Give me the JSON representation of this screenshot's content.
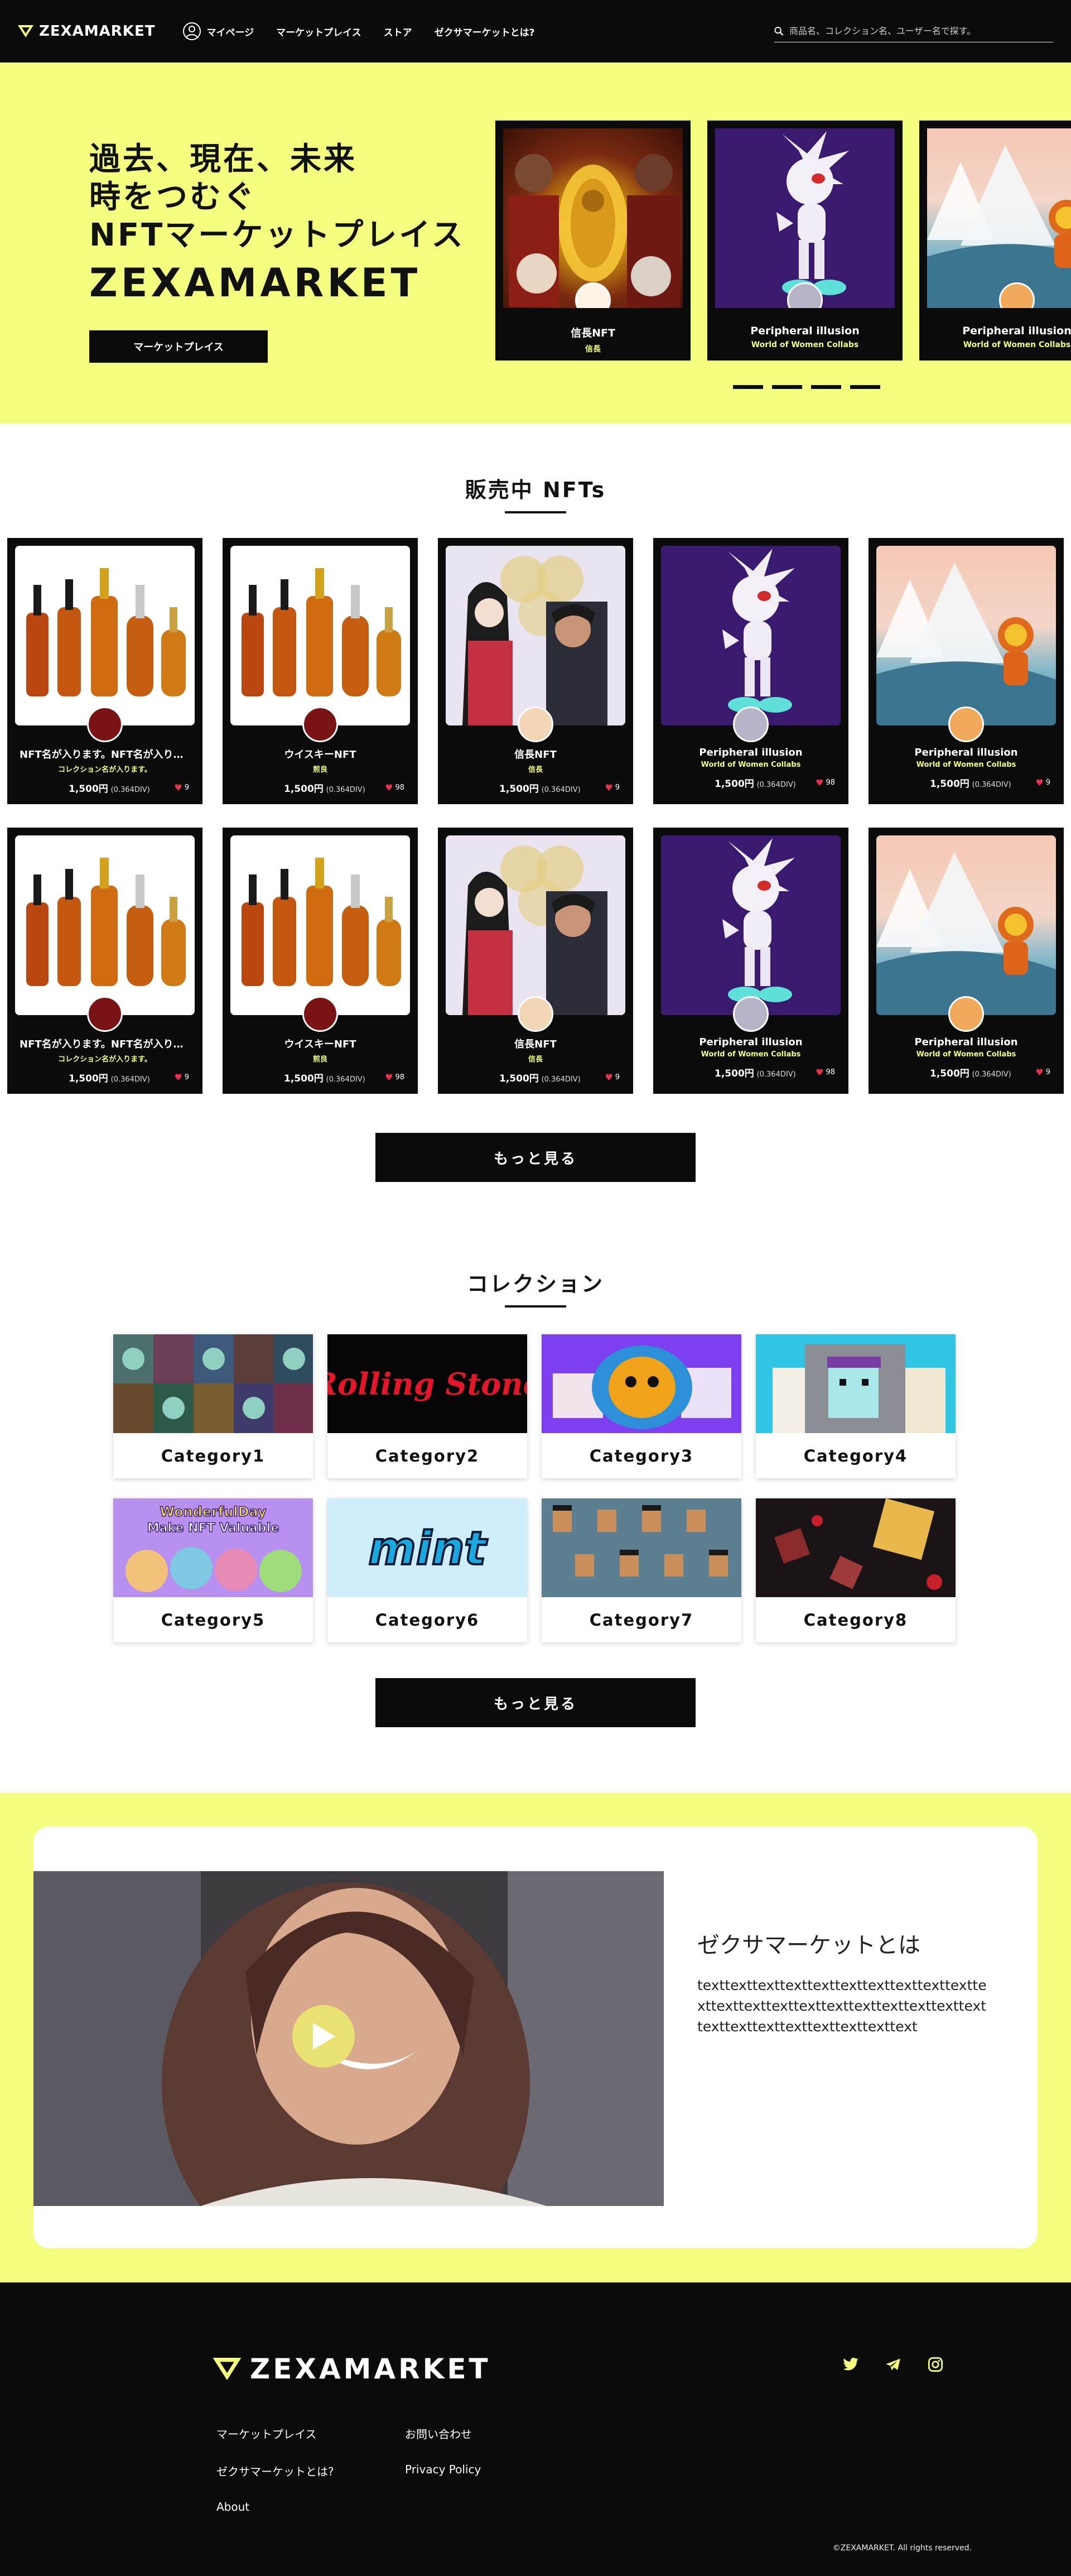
{
  "header": {
    "logo": "ZEXAMARKET",
    "nav": [
      {
        "label": "マイページ"
      },
      {
        "label": "マーケットプレイス"
      },
      {
        "label": "ストア"
      },
      {
        "label": "ゼクサマーケットとは?"
      }
    ],
    "search_placeholder": "商品名、コレクション名、ユーザー名で探す。"
  },
  "hero": {
    "lines": [
      "過去、現在、未来",
      "時をつむぐ",
      "NFTマーケットプレイス"
    ],
    "brand": "ZEXAMARKET",
    "button": "マーケットプレイス",
    "cards": [
      {
        "title": "信長NFT",
        "sub": "信長"
      },
      {
        "title": "Peripheral illusion",
        "sub": "World of Women Collabs"
      },
      {
        "title": "Peripheral illusion",
        "sub": "World of Women Collabs"
      }
    ],
    "dots": 4
  },
  "nfts": {
    "title": "販売中 NFTs",
    "items": [
      {
        "title": "NFT名が入ります。NFT名が入ります。",
        "sub": "コレクション名が入ります。",
        "price": "1,500円",
        "eth": "(0.364DIV)",
        "likes": "9"
      },
      {
        "title": "ウイスキーNFT",
        "sub": "煎良",
        "price": "1,500円",
        "eth": "(0.364DIV)",
        "likes": "98"
      },
      {
        "title": "信長NFT",
        "sub": "信長",
        "price": "1,500円",
        "eth": "(0.364DIV)",
        "likes": "9"
      },
      {
        "title": "Peripheral illusion",
        "sub": "World of Women Collabs",
        "price": "1,500円",
        "eth": "(0.364DIV)",
        "likes": "98"
      },
      {
        "title": "Peripheral illusion",
        "sub": "World of Women Collabs",
        "price": "1,500円",
        "eth": "(0.364DIV)",
        "likes": "9"
      },
      {
        "title": "NFT名が入ります。NFT名が入ります。",
        "sub": "コレクション名が入ります。",
        "price": "1,500円",
        "eth": "(0.364DIV)",
        "likes": "9"
      },
      {
        "title": "ウイスキーNFT",
        "sub": "煎良",
        "price": "1,500円",
        "eth": "(0.364DIV)",
        "likes": "98"
      },
      {
        "title": "信長NFT",
        "sub": "信長",
        "price": "1,500円",
        "eth": "(0.364DIV)",
        "likes": "9"
      },
      {
        "title": "Peripheral illusion",
        "sub": "World of Women Collabs",
        "price": "1,500円",
        "eth": "(0.364DIV)",
        "likes": "98"
      },
      {
        "title": "Peripheral illusion",
        "sub": "World of Women Collabs",
        "price": "1,500円",
        "eth": "(0.364DIV)",
        "likes": "9"
      }
    ],
    "more": "もっと見る"
  },
  "collections": {
    "title": "コレクション",
    "items": [
      {
        "label": "Category1",
        "image_text": ""
      },
      {
        "label": "Category2",
        "image_text": "Rolling Stone"
      },
      {
        "label": "Category3",
        "image_text": ""
      },
      {
        "label": "Category4",
        "image_text": ""
      },
      {
        "label": "Category5",
        "image_text": "WonderfulDay Make NFT Valuable"
      },
      {
        "label": "Category6",
        "image_text": "mint"
      },
      {
        "label": "Category7",
        "image_text": ""
      },
      {
        "label": "Category8",
        "image_text": ""
      }
    ],
    "more": "もっと見る"
  },
  "about": {
    "title": "ゼクサマーケットとは",
    "body": "texttexttexttexttexttexttexttexttexttexttexttexttexttexttexttexttexttexttexttexttexttexttexttexttexttexttexttexttext"
  },
  "footer": {
    "logo": "ZEXAMARKET",
    "links": [
      "マーケットプレイス",
      "お問い合わせ",
      "ゼクサマーケットとは?",
      "Privacy Policy",
      "About"
    ],
    "social": [
      "twitter-icon",
      "telegram-icon",
      "instagram-icon"
    ],
    "copyright": "©ZEXAMARKET. All rights reserved."
  },
  "colors": {
    "accent": "#f4ff80",
    "dark": "#0b0b0b",
    "heart": "#e8324c"
  }
}
